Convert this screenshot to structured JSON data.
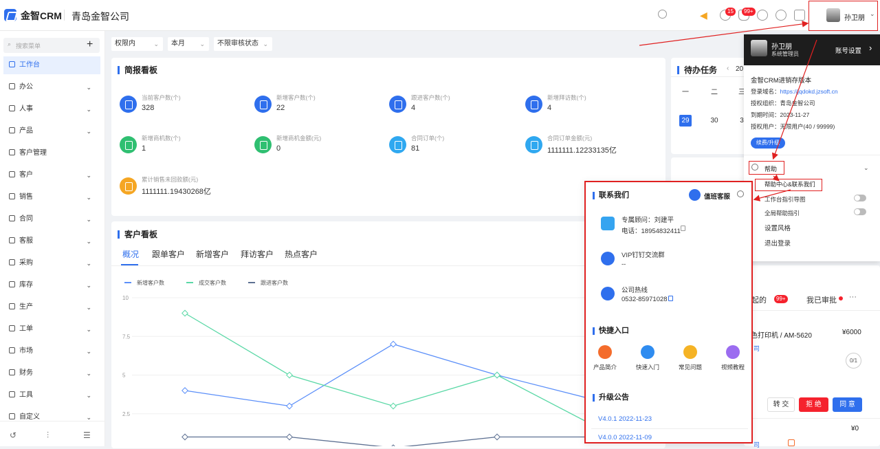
{
  "header": {
    "app_name": "金智CRM",
    "company": "青岛金智公司",
    "user_name": "孙卫朋",
    "badge_message": "15",
    "badge_notify": "99+"
  },
  "sidebar": {
    "search_placeholder": "搜索菜单",
    "items": [
      {
        "label": "工作台",
        "icon": "dashboard-icon",
        "expandable": false,
        "active": true
      },
      {
        "label": "办公",
        "icon": "office-icon",
        "expandable": true
      },
      {
        "label": "人事",
        "icon": "people-icon",
        "expandable": true
      },
      {
        "label": "产品",
        "icon": "product-icon",
        "expandable": true
      },
      {
        "label": "客户管理",
        "icon": "customer-manage-icon",
        "expandable": false
      },
      {
        "label": "客户",
        "icon": "customer-icon",
        "expandable": true
      },
      {
        "label": "销售",
        "icon": "sales-icon",
        "expandable": true
      },
      {
        "label": "合同",
        "icon": "contract-icon",
        "expandable": true
      },
      {
        "label": "客服",
        "icon": "service-icon",
        "expandable": true
      },
      {
        "label": "采购",
        "icon": "purchase-icon",
        "expandable": true
      },
      {
        "label": "库存",
        "icon": "stock-icon",
        "expandable": true
      },
      {
        "label": "生产",
        "icon": "production-icon",
        "expandable": true
      },
      {
        "label": "工单",
        "icon": "workorder-icon",
        "expandable": true
      },
      {
        "label": "市场",
        "icon": "market-icon",
        "expandable": true
      },
      {
        "label": "财务",
        "icon": "finance-icon",
        "expandable": true
      },
      {
        "label": "工具",
        "icon": "tools-icon",
        "expandable": true
      },
      {
        "label": "自定义",
        "icon": "custom-icon",
        "expandable": true
      }
    ]
  },
  "filters": {
    "scope": "权限内",
    "period": "本月",
    "audit": "不限审核状态"
  },
  "briefing": {
    "title": "简报看板",
    "stats": [
      {
        "label": "当前客户数(个)",
        "value": "328",
        "color": "#2f6fed"
      },
      {
        "label": "新增客户数(个)",
        "value": "22",
        "color": "#2f6fed"
      },
      {
        "label": "跟进客户数(个)",
        "value": "4",
        "color": "#2f6fed"
      },
      {
        "label": "新增拜访数(个)",
        "value": "4",
        "color": "#2f6fed"
      },
      {
        "label": "新增商机数(个)",
        "value": "1",
        "color": "#2fbf71"
      },
      {
        "label": "新增商机金额(元)",
        "value": "0",
        "color": "#2fbf71"
      },
      {
        "label": "合同订单(个)",
        "value": "81",
        "color": "#2fa8f0"
      },
      {
        "label": "合同订单金额(元)",
        "value": "1111111.12233135亿",
        "color": "#2fa8f0"
      },
      {
        "label": "累计销售未回款额(元)",
        "value": "1111111.19430268亿",
        "color": "#f5a623"
      }
    ]
  },
  "customer_board": {
    "title": "客户看板",
    "tabs": [
      "概况",
      "跟单客户",
      "新增客户",
      "拜访客户",
      "热点客户"
    ],
    "active_tab": 0
  },
  "chart_data": {
    "type": "line",
    "x": [
      1,
      2,
      3,
      4,
      5
    ],
    "ylim": [
      0,
      10
    ],
    "yticks": [
      "2.5",
      "5",
      "7.5",
      "10"
    ],
    "series": [
      {
        "name": "新增客户数",
        "color": "#5b8ff9",
        "values": [
          4,
          3,
          7,
          5,
          3.3
        ]
      },
      {
        "name": "成交客户数",
        "color": "#5ad8a6",
        "values": [
          9,
          5,
          3,
          5,
          1.5
        ]
      },
      {
        "name": "跟进客户数",
        "color": "#5d7092",
        "values": [
          1,
          1,
          0.3,
          1,
          1
        ]
      }
    ]
  },
  "todo": {
    "title": "待办任务",
    "month_prefix": "20",
    "weekdays": [
      "一",
      "二",
      "三"
    ],
    "days": [
      "29",
      "30",
      "3"
    ]
  },
  "approval": {
    "tab1": "发起的",
    "tab1_badge": "99+",
    "tab2": "我已审批",
    "item_title": "色打印机 / AM-5620",
    "item_price": "¥6000",
    "item_tag": "司",
    "progress": "0/1",
    "btn_transfer": "转 交",
    "btn_reject": "拒 绝",
    "btn_agree": "同 意",
    "item2_price": "¥0",
    "item2_tag": "司"
  },
  "user_dropdown": {
    "name": "孙卫朋",
    "role": "系统管理员",
    "account_settings": "账号设置",
    "edition": "金智CRM进销存版本",
    "domain_label": "登录域名：",
    "domain": "https://jqdokd.jzsoft.cn",
    "org_label": "授权组织：",
    "org": "青岛金智公司",
    "expire_label": "到期时间：",
    "expire": "2023-11-27",
    "users_label": "授权用户：",
    "users": "无限用户(40 / 99999)",
    "renew": "续费/升级",
    "help": "帮助",
    "help_center": "帮助中心&联系我们",
    "guide_map": "工作台指引导图",
    "global_guide": "全局帮助指引",
    "style": "设置风格",
    "logout": "退出登录"
  },
  "contact": {
    "title": "联系我们",
    "duty": "值班客服",
    "advisor_label": "专属顾问：刘建平",
    "advisor_phone": "电话：18954832411",
    "vip_label": "VIP钉钉交流群",
    "vip_value": "--",
    "hotline_label": "公司热线",
    "hotline_value": "0532-85971028",
    "quick_title": "快捷入口",
    "quick_links": [
      {
        "label": "产品简介",
        "color": "#f46c2b"
      },
      {
        "label": "快速入门",
        "color": "#2f8cf0"
      },
      {
        "label": "常见问题",
        "color": "#f5b325"
      },
      {
        "label": "视频教程",
        "color": "#9b6cf0"
      }
    ],
    "announce_title": "升级公告",
    "announcements": [
      "V4.0.1 2022-11-23",
      "V4.0.0 2022-11-09"
    ]
  }
}
